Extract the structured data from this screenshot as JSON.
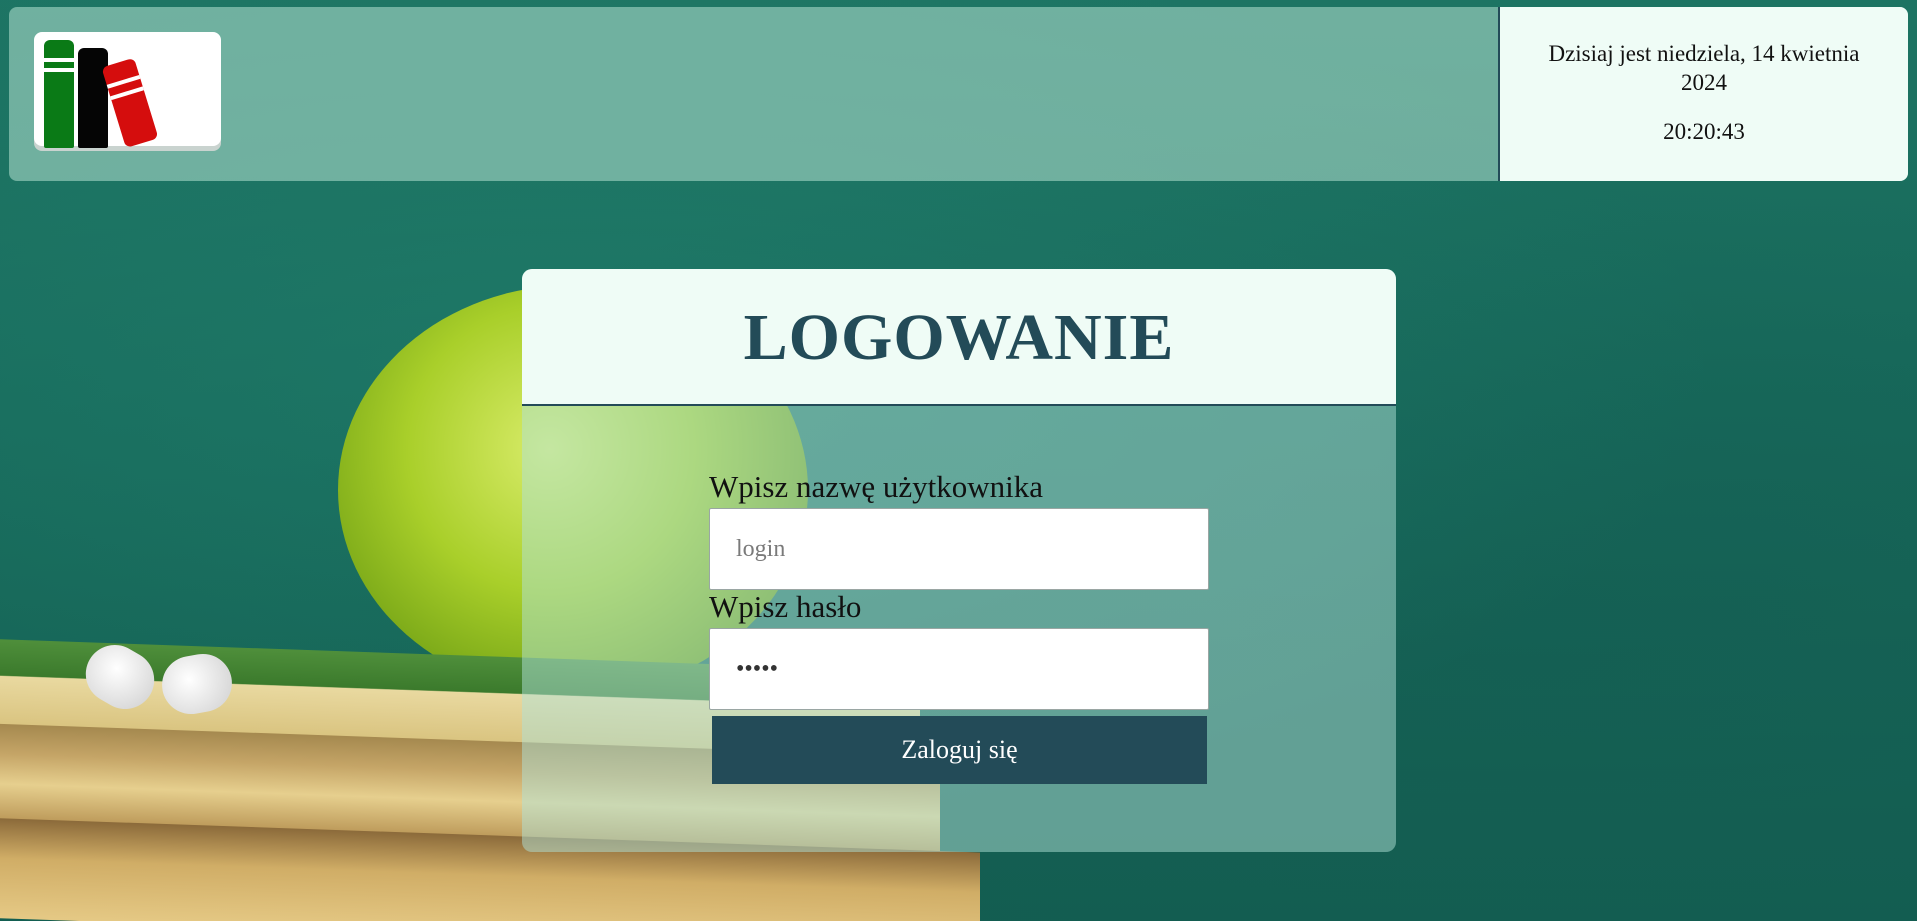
{
  "header": {
    "logo": "books-logo",
    "date_text": "Dzisiaj jest niedziela, 14 kwietnia 2024",
    "time_text": "20:20:43"
  },
  "login": {
    "title": "LOGOWANIE",
    "username_label": "Wpisz nazwę użytkownika",
    "username_placeholder": "login",
    "password_label": "Wpisz hasło",
    "password_value": "aaaaa",
    "submit_label": "Zaloguj się"
  },
  "colors": {
    "accent": "#234b58",
    "panel": "#effcf6",
    "logo_green": "#0a7a16",
    "logo_black": "#050505",
    "logo_red": "#d50d0d"
  }
}
